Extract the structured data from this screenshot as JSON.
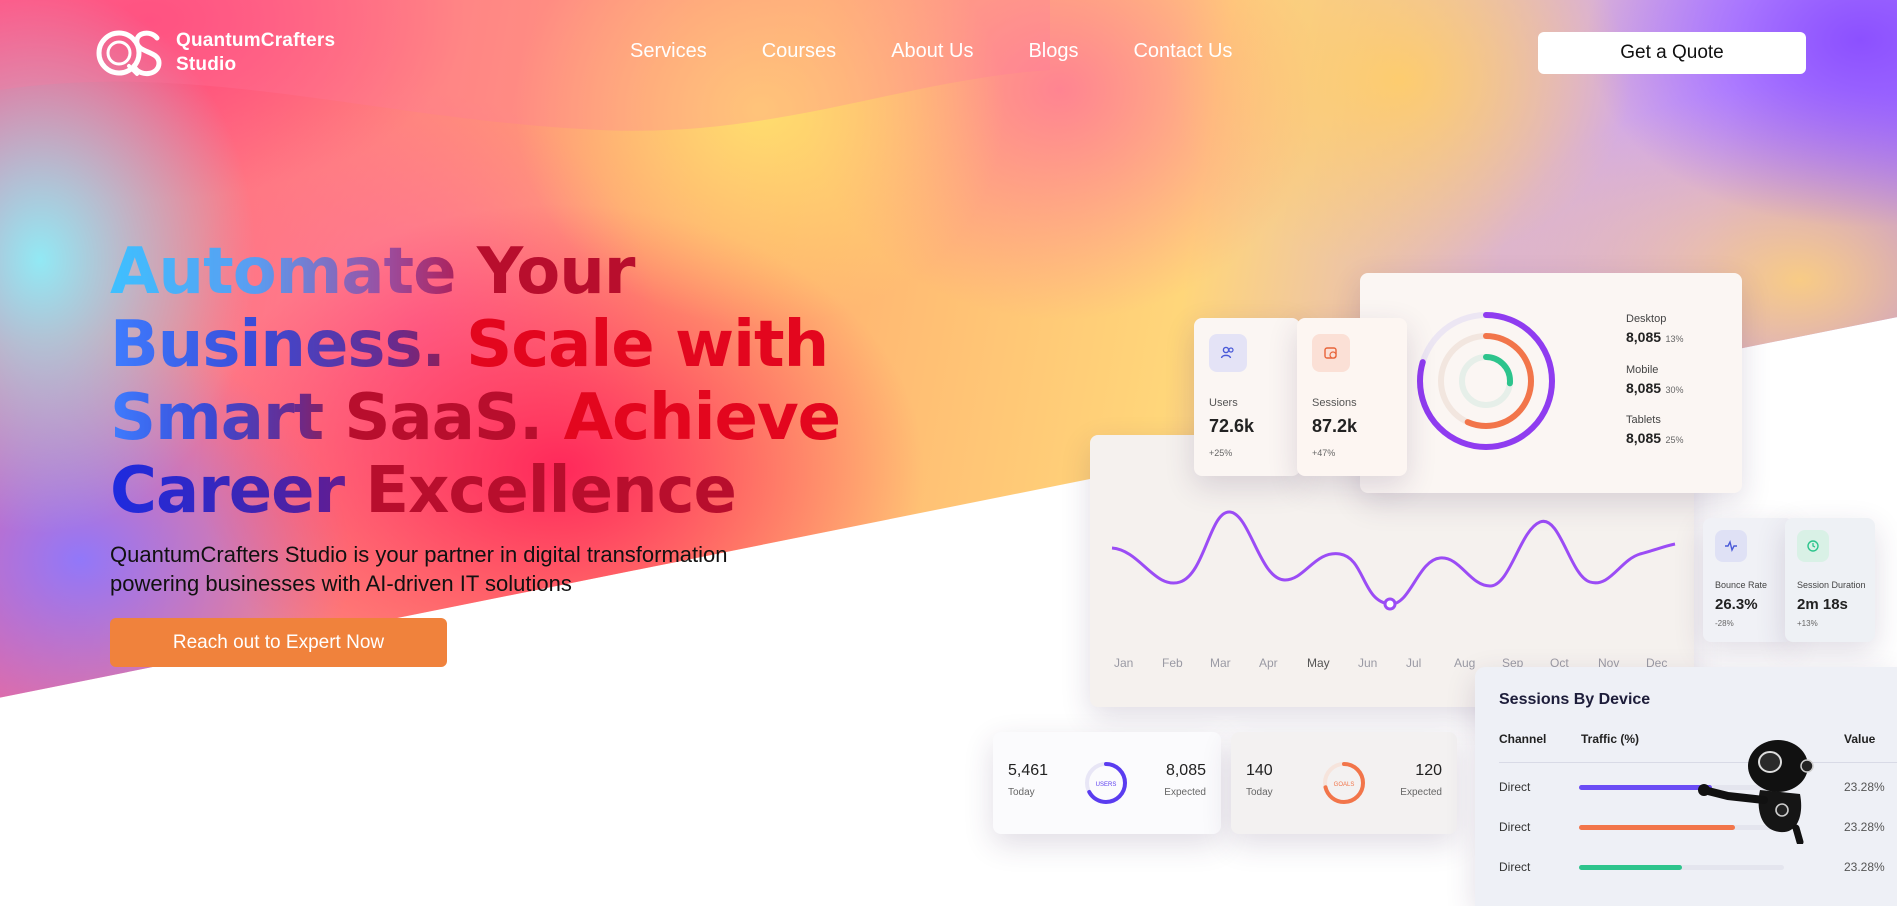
{
  "brand": {
    "line1": "QuantumCrafters",
    "line2": "Studio"
  },
  "nav": {
    "items": [
      "Services",
      "Courses",
      "About Us",
      "Blogs",
      "Contact Us"
    ]
  },
  "header": {
    "quote_label": "Get a Quote"
  },
  "hero": {
    "headline": {
      "l1a": "Automate ",
      "l1b": "Your",
      "l2a": "Business. ",
      "l2b": "Scale with",
      "l3a": "Smart ",
      "l3b": "SaaS. ",
      "l3c": "Achieve",
      "l4a": "Career ",
      "l4b": "Excellence"
    },
    "subtext_line1": "QuantumCrafters Studio is your partner in digital transformation",
    "subtext_line2": "powering businesses with AI-driven IT solutions",
    "cta_label": "Reach out to Expert Now"
  },
  "dashboard": {
    "users": {
      "label": "Users",
      "value": "72.6k",
      "change": "+25%",
      "icon": "users-icon"
    },
    "sessions": {
      "label": "Sessions",
      "value": "87.2k",
      "change": "+47%",
      "icon": "sessions-icon"
    },
    "devices": [
      {
        "label": "Desktop",
        "value": "8,085",
        "pct": "13%"
      },
      {
        "label": "Mobile",
        "value": "8,085",
        "pct": "30%"
      },
      {
        "label": "Tablets",
        "value": "8,085",
        "pct": "25%"
      }
    ],
    "months": [
      "Jan",
      "Feb",
      "Mar",
      "Apr",
      "May",
      "Jun",
      "Jul",
      "Aug",
      "Sep",
      "Oct",
      "Nov",
      "Dec"
    ],
    "bounce": {
      "label": "Bounce Rate",
      "value": "26.3%",
      "change": "-28%"
    },
    "duration": {
      "label": "Session Duration",
      "value": "2m 18s",
      "change": "+13%"
    },
    "users_mini": {
      "today": "5,461",
      "today_label": "Today",
      "ring": "USERS",
      "expected": "8,085",
      "expected_label": "Expected"
    },
    "goals_mini": {
      "today": "140",
      "today_label": "Today",
      "ring": "GOALS",
      "expected": "120",
      "expected_label": "Expected"
    },
    "sessions_by_device": {
      "title": "Sessions By Device",
      "col_channel": "Channel",
      "col_traffic": "Traffic (%)",
      "col_value": "Value",
      "rows": [
        {
          "channel": "Direct",
          "value": "23.28%",
          "fill": 0.65,
          "color": "#6a4cf5"
        },
        {
          "channel": "Direct",
          "value": "23.28%",
          "fill": 0.76,
          "color": "#f2754a"
        },
        {
          "channel": "Direct",
          "value": "23.28%",
          "fill": 0.5,
          "color": "#2dc48c"
        }
      ]
    }
  },
  "colors": {
    "accent_orange": "#f0823c",
    "purple": "#8f3cf0",
    "red": "#e3061e"
  }
}
